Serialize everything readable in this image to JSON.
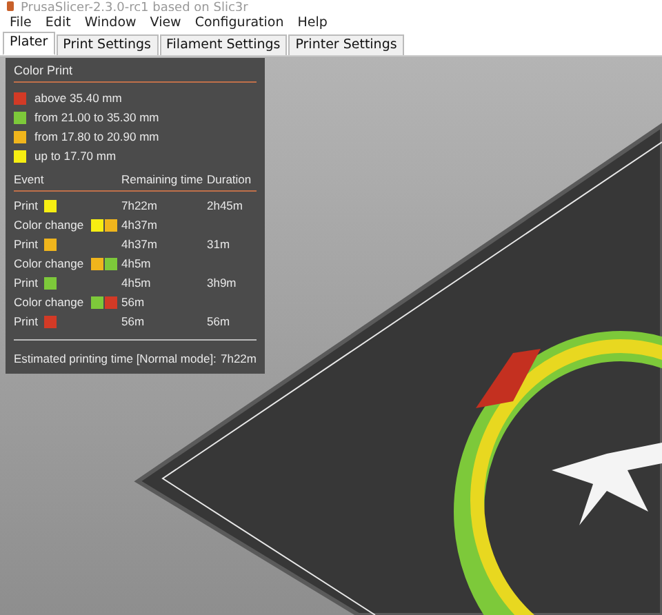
{
  "window": {
    "title": "PrusaSlicer-2.3.0-rc1 based on Slic3r"
  },
  "menu": [
    "File",
    "Edit",
    "Window",
    "View",
    "Configuration",
    "Help"
  ],
  "tabs": [
    {
      "label": "Plater",
      "selected": true
    },
    {
      "label": "Print Settings",
      "selected": false
    },
    {
      "label": "Filament Settings",
      "selected": false
    },
    {
      "label": "Printer Settings",
      "selected": false
    }
  ],
  "color_print": {
    "title": "Color Print",
    "legend": [
      {
        "label": "above 35.40 mm",
        "color": "#d23a26"
      },
      {
        "label": "from 21.00 to 35.30 mm",
        "color": "#7dc93a"
      },
      {
        "label": "from 17.80 to 20.90 mm",
        "color": "#f0b51c"
      },
      {
        "label": "up to 17.70 mm",
        "color": "#f6ee12"
      }
    ],
    "columns": [
      "Event",
      "Remaining time",
      "Duration"
    ],
    "events": [
      {
        "label": "Print",
        "swatches": [
          {
            "color": "#f6ee12"
          }
        ],
        "remaining": "7h22m",
        "duration": "2h45m"
      },
      {
        "label": "Color change",
        "swatches": [
          {
            "color": "#f6ee12"
          },
          {
            "color": "#f0b51c"
          }
        ],
        "remaining": "4h37m"
      },
      {
        "label": "Print",
        "swatches": [
          {
            "color": "#f0b51c"
          }
        ],
        "remaining": "4h37m",
        "duration": "31m"
      },
      {
        "label": "Color change",
        "swatches": [
          {
            "color": "#f0b51c"
          },
          {
            "color": "#7dc93a"
          }
        ],
        "remaining": "4h5m"
      },
      {
        "label": "Print",
        "swatches": [
          {
            "color": "#7dc93a"
          }
        ],
        "remaining": "4h5m",
        "duration": "3h9m"
      },
      {
        "label": "Color change",
        "swatches": [
          {
            "color": "#7dc93a"
          },
          {
            "color": "#d23a26"
          }
        ],
        "remaining": "56m"
      },
      {
        "label": "Print",
        "swatches": [
          {
            "color": "#d23a26"
          }
        ],
        "remaining": "56m",
        "duration": "56m"
      }
    ],
    "estimate_label": "Estimated printing time [Normal mode]:",
    "estimate_value": "7h22m"
  }
}
